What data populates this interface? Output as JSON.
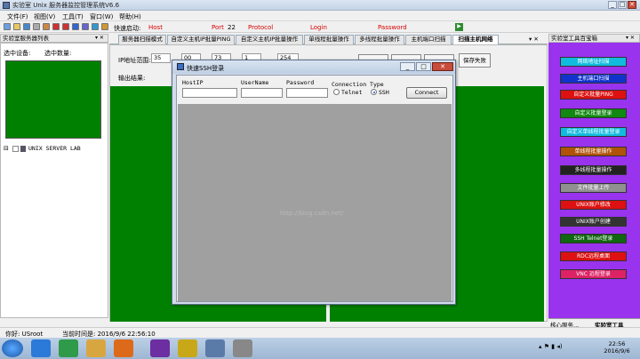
{
  "window": {
    "title": "实验室 Unix 服务器监控管理系统V6.6",
    "min": "_",
    "max": "□",
    "close": "✕"
  },
  "menu": [
    "文件(F)",
    "视图(V)",
    "工具(T)",
    "窗口(W)",
    "帮助(H)"
  ],
  "quick": {
    "label": "快速启动:",
    "host": "Host",
    "port_label": "Port",
    "port": "22",
    "protocol": "Protocol",
    "login": "Login",
    "password": "Password",
    "go": "▶"
  },
  "left": {
    "title": "实验室服务器列表",
    "pin": "▾ ✕",
    "sel_device": "选中设备:",
    "sel_count": "选中数量:",
    "tree_item": "UNIX SERVER LAB",
    "tree_expander": "⊟"
  },
  "tabs": [
    "服务器扫描模式",
    "自定义主机IP批量PING",
    "自定义主机IP批量操作",
    "单线程批量操作",
    "多线程批量操作",
    "主机端口扫描",
    "扫描主机网络"
  ],
  "tab_controls": "▾ ✕",
  "scan": {
    "ip_label": "IP地址范围:",
    "ip1": "35",
    "ip2": "00",
    "ip3": "73",
    "ip4": "1",
    "ip5": "254",
    "save": "保存失败",
    "output": "输出结果:"
  },
  "right": {
    "title": "实验室工具百宝箱",
    "pin": "▾ ✕",
    "buttons": [
      {
        "label": "网络地址扫描",
        "color": "#11bbdd"
      },
      {
        "label": "主机端口扫描",
        "color": "#1133cc"
      },
      {
        "label": "自定义批量PING",
        "color": "#dd1111"
      },
      {
        "label": "自定义批量登录",
        "color": "#118811"
      },
      {
        "label": "自定义单线程批量登录",
        "color": "#11bbdd"
      },
      {
        "label": "单线程批量操作",
        "color": "#b0520a"
      },
      {
        "label": "多线程批量操作",
        "color": "#222222"
      },
      {
        "label": "文件批量上传",
        "color": "#909090"
      },
      {
        "label": "UNIX账户修改",
        "color": "#dd1111"
      },
      {
        "label": "UNIX账户创建",
        "color": "#333333"
      },
      {
        "label": "SSH Telnet登录",
        "color": "#116611"
      },
      {
        "label": "RDC远程桌面",
        "color": "#dd1111"
      },
      {
        "label": "VNC 远程登录",
        "color": "#dd2266"
      }
    ],
    "bottom_tab1": "核心服务...",
    "bottom_tab2": "实验室工具"
  },
  "status": {
    "user": "你好: USroot",
    "time": "当前时间是: 2016/9/6 22:56:10"
  },
  "dialog": {
    "title": "快速SSH登录",
    "min": "_",
    "max": "□",
    "close": "✕",
    "host_ip": "HostIP",
    "user_name": "UserName",
    "password": "Password",
    "connection_type": "Connection Type",
    "telnet": "Telnet",
    "ssh": "SSH",
    "connect": "Connect"
  },
  "watermark": "http://blog.csdn.net/",
  "taskbar": {
    "clock_time": "22:56",
    "clock_date": "2016/9/6",
    "tray": "▴ ⚑ ▮ ◂)"
  }
}
